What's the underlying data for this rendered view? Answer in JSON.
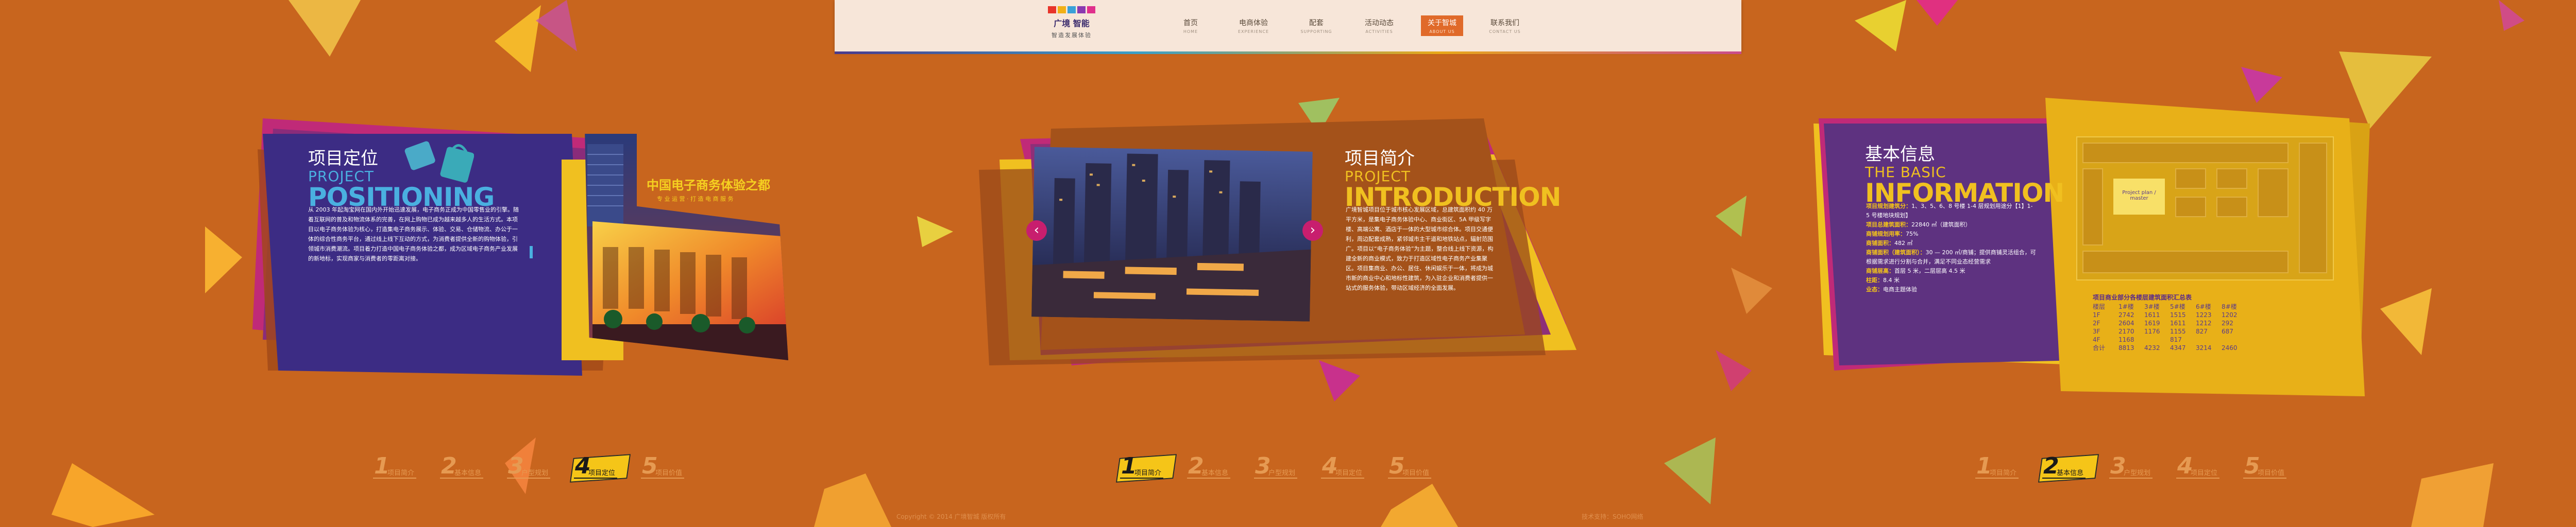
{
  "nav": {
    "logo_title": "广境 智能",
    "logo_sub": "智造发展体验",
    "items": [
      {
        "zh": "首页",
        "en": "HOME"
      },
      {
        "zh": "电商体验",
        "en": "EXPERIENCE"
      },
      {
        "zh": "配套",
        "en": "SUPPORTING"
      },
      {
        "zh": "活动动态",
        "en": "ACTIVITIES"
      },
      {
        "zh": "关于智城",
        "en": "ABOUT US"
      },
      {
        "zh": "联系我们",
        "en": "CONTACT US"
      }
    ]
  },
  "positioning": {
    "title_zh": "项目定位",
    "title_en1": "PROJECT",
    "title_en2": "POSITIONING",
    "slogan": "中国电子商务体验之都",
    "slogan_sub": "专 业 运 营 · 打 造 电 商 服 务",
    "body": "从 2003 年起淘宝网在国内外开始迅速发展，电子商务正成为中国零售业的引擎。随着互联网的普及和物流体系的完善，在网上购物已成为越来越多人的生活方式。本项目以电子商务体验为核心，打造集电子商务展示、体验、交易、仓储物流、办公于一体的综合性商务平台，通过线上线下互动的方式，为消费者提供全新的购物体验，引领城市消费潮流。项目着力打造中国电子商务体验之都，成为区域电子商务产业发展的新地标，实现商家与消费者的零距离对接。"
  },
  "introduction": {
    "title_zh": "项目简介",
    "title_en1": "PROJECT",
    "title_en2": "INTRODUCTION",
    "body": "广境智城项目位于城市核心发展区域，总建筑面积约 40 万平方米，是集电子商务体验中心、商业街区、5A 甲级写字楼、高端公寓、酒店于一体的大型城市综合体。项目交通便利，周边配套成熟，紧邻城市主干道和地铁站点，辐射范围广。项目以“电子商务体验”为主题，整合线上线下资源，构建全新的商业模式，致力于打造区域性电子商务产业集聚区。项目集商业、办公、居住、休闲娱乐于一体，将成为城市新的商业中心和地标性建筑，为入驻企业和消费者提供一站式的服务体验，带动区域经济的全面发展。"
  },
  "info": {
    "title_zh": "基本信息",
    "title_en1": "THE BASIC",
    "title_en2": "INFORMATION",
    "items": [
      {
        "k": "项目规划建筑分：",
        "v": "1、3、5、6、8 号楼 1-4 层规划用途分【1】1-5 号楼地块规划】"
      },
      {
        "k": "项目总建筑面积：",
        "v": "22840 ㎡（建筑面积）"
      },
      {
        "k": "商铺规划用率：",
        "v": "75%"
      },
      {
        "k": "商铺面积：",
        "v": "482 ㎡"
      },
      {
        "k": "商铺面积（建筑面积）：",
        "v": "30 — 200 ㎡/商铺；提供商铺灵活组合，可根据需求进行分割与合并，满足不同业态经营需求"
      },
      {
        "k": "商铺层高：",
        "v": "首层 5 米，二层层高 4.5 米"
      },
      {
        "k": "柱距：",
        "v": "8.4 米"
      },
      {
        "k": "业态：",
        "v": "电商主题体验"
      }
    ],
    "plan_caption": "Project plan / master",
    "table_title": "项目商业部分各楼层建筑面积汇总表",
    "table_header": [
      "楼层",
      "1#楼",
      "3#楼",
      "5#楼",
      "6#楼",
      "8#楼"
    ],
    "table_rows": [
      [
        "1F",
        "2742",
        "1611",
        "1515",
        "1223",
        "1202"
      ],
      [
        "2F",
        "2604",
        "1619",
        "1611",
        "1212",
        "292"
      ],
      [
        "3F",
        "2170",
        "1176",
        "1155",
        "827",
        "687"
      ],
      [
        "4F",
        "1168",
        "",
        "817",
        "",
        ""
      ],
      [
        "合计",
        "8813",
        "4232",
        "4347",
        "3214",
        "2460"
      ]
    ]
  },
  "pager": [
    {
      "num": "1",
      "label": "项目简介"
    },
    {
      "num": "2",
      "label": "基本信息"
    },
    {
      "num": "3",
      "label": "户型规划"
    },
    {
      "num": "4",
      "label": "项目定位"
    },
    {
      "num": "5",
      "label": "项目价值"
    }
  ],
  "footer": {
    "left": "Copyright © 2014 广境智城 版权所有",
    "right": "技术支持：SOHO网络"
  },
  "colors": {
    "background": "#c8651e",
    "purple": "#3e2f86",
    "yellow": "#f0c020",
    "magenta": "#c82078"
  }
}
